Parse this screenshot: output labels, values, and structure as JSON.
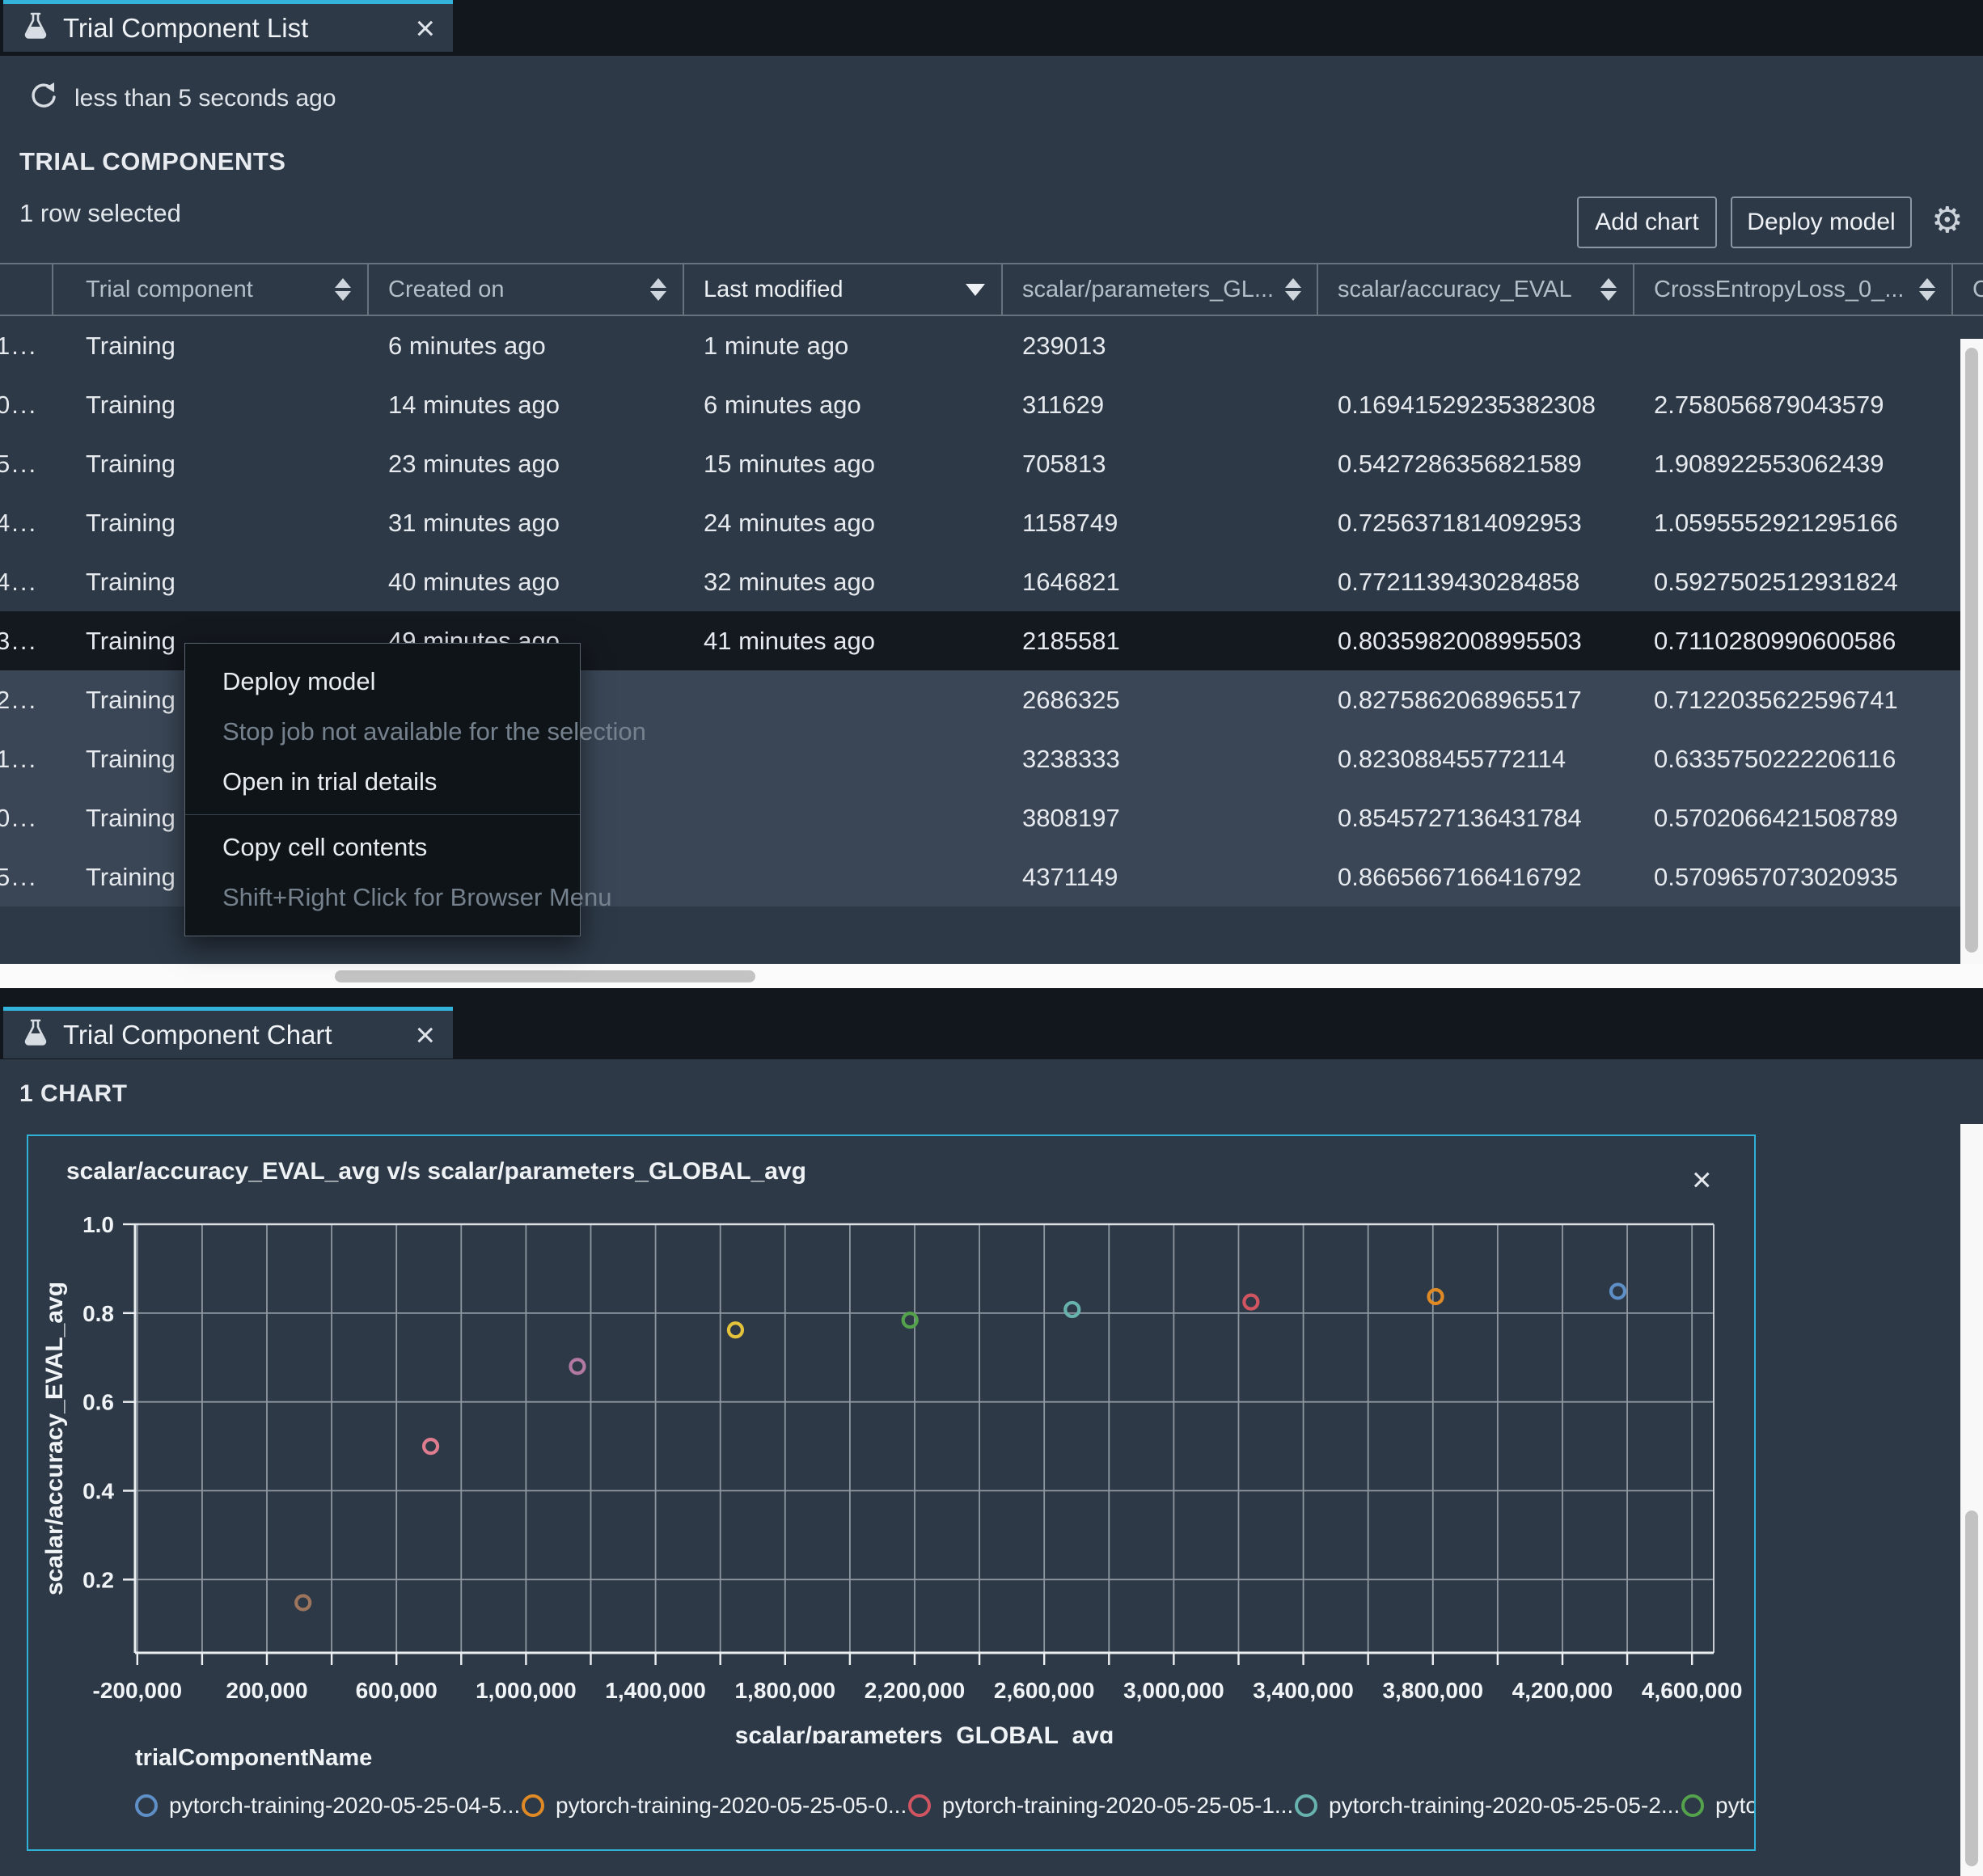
{
  "icons": {
    "close": "×",
    "gear": "⚙",
    "flask": "flask",
    "refresh": "refresh"
  },
  "window1": {
    "tab": {
      "title": "Trial Component List"
    },
    "refresh_status": "less than 5 seconds ago",
    "section_title": "TRIAL COMPONENTS",
    "selection_status": "1 row selected",
    "buttons": {
      "add_chart": "Add chart",
      "deploy_model": "Deploy model"
    },
    "table": {
      "columns": [
        {
          "label": "",
          "sort": "none"
        },
        {
          "label": "Trial component",
          "sort": "both"
        },
        {
          "label": "Created on",
          "sort": "both"
        },
        {
          "label": "Last modified",
          "sort": "desc"
        },
        {
          "label": "scalar/parameters_GL...",
          "sort": "both"
        },
        {
          "label": "scalar/accuracy_EVAL",
          "sort": "both"
        },
        {
          "label": "CrossEntropyLoss_0_...",
          "sort": "both"
        },
        {
          "label": "C",
          "sort": "none"
        }
      ],
      "rows": [
        {
          "name_fragment": "1...",
          "trial_component": "Training",
          "created_on": "6 minutes ago",
          "last_modified": "1 minute ago",
          "parameters": "239013",
          "accuracy": "",
          "loss": "",
          "selected": false
        },
        {
          "name_fragment": "0...",
          "trial_component": "Training",
          "created_on": "14 minutes ago",
          "last_modified": "6 minutes ago",
          "parameters": "311629",
          "accuracy": "0.16941529235382308",
          "loss": "2.758056879043579",
          "selected": false
        },
        {
          "name_fragment": "5...",
          "trial_component": "Training",
          "created_on": "23 minutes ago",
          "last_modified": "15 minutes ago",
          "parameters": "705813",
          "accuracy": "0.5427286356821589",
          "loss": "1.908922553062439",
          "selected": false
        },
        {
          "name_fragment": "4...",
          "trial_component": "Training",
          "created_on": "31 minutes ago",
          "last_modified": "24 minutes ago",
          "parameters": "1158749",
          "accuracy": "0.7256371814092953",
          "loss": "1.0595552921295166",
          "selected": false
        },
        {
          "name_fragment": "4...",
          "trial_component": "Training",
          "created_on": "40 minutes ago",
          "last_modified": "32 minutes ago",
          "parameters": "1646821",
          "accuracy": "0.7721139430284858",
          "loss": "0.5927502512931824",
          "selected": false
        },
        {
          "name_fragment": "3...",
          "trial_component": "Training",
          "created_on": "49 minutes ago",
          "last_modified": "41 minutes ago",
          "parameters": "2185581",
          "accuracy": "0.8035982008995503",
          "loss": "0.7110280990600586",
          "selected": true
        },
        {
          "name_fragment": "2...",
          "trial_component": "Training",
          "created_on": "",
          "last_modified": "",
          "parameters": "2686325",
          "accuracy": "0.8275862068965517",
          "loss": "0.7122035622596741",
          "selected": false
        },
        {
          "name_fragment": "1...",
          "trial_component": "Training",
          "created_on": "",
          "last_modified": "",
          "parameters": "3238333",
          "accuracy": "0.823088455772114",
          "loss": "0.6335750222206116",
          "selected": false
        },
        {
          "name_fragment": "0...",
          "trial_component": "Training",
          "created_on": "",
          "last_modified": "",
          "parameters": "3808197",
          "accuracy": "0.8545727136431784",
          "loss": "0.5702066421508789",
          "selected": false
        },
        {
          "name_fragment": "5...",
          "trial_component": "Training",
          "created_on": "",
          "last_modified": "",
          "parameters": "4371149",
          "accuracy": "0.8665667166416792",
          "loss": "0.5709657073020935",
          "selected": false
        }
      ]
    },
    "context_menu": {
      "items": [
        {
          "type": "item",
          "label": "Deploy model",
          "enabled": true
        },
        {
          "type": "item",
          "label": "Stop job not available for the selection",
          "enabled": false
        },
        {
          "type": "item",
          "label": "Open in trial details",
          "enabled": true
        },
        {
          "type": "separator"
        },
        {
          "type": "item",
          "label": "Copy cell contents",
          "enabled": true
        },
        {
          "type": "item",
          "label": "Shift+Right Click for Browser Menu",
          "enabled": false
        }
      ]
    }
  },
  "window2": {
    "tab": {
      "title": "Trial Component Chart"
    },
    "section_title": "1 CHART",
    "card_title": "scalar/accuracy_EVAL_avg v/s scalar/parameters_GLOBAL_avg"
  },
  "chart_data": {
    "type": "scatter",
    "title": "scalar/accuracy_EVAL_avg v/s scalar/parameters_GLOBAL_avg",
    "xlabel": "scalar/parameters_GLOBAL_avg",
    "ylabel": "scalar/accuracy_EVAL_avg",
    "xlim": [
      -207000,
      4667000
    ],
    "ylim": [
      0.035,
      1.0
    ],
    "x_ticks": [
      -200000,
      200000,
      600000,
      1000000,
      1400000,
      1800000,
      2200000,
      2600000,
      3000000,
      3400000,
      3800000,
      4200000,
      4600000
    ],
    "x_minor_step": 200000,
    "y_ticks": [
      0.2,
      0.4,
      0.6,
      0.8,
      1.0
    ],
    "grid": true,
    "legend_position": "bottom",
    "legend_title": "trialComponentName",
    "points": [
      {
        "x": 311629,
        "y": 0.148,
        "color": "#9d755d"
      },
      {
        "x": 705813,
        "y": 0.5,
        "color": "#e07c90"
      },
      {
        "x": 1158749,
        "y": 0.68,
        "color": "#b279a2"
      },
      {
        "x": 1646821,
        "y": 0.762,
        "color": "#e2c33b"
      },
      {
        "x": 2185581,
        "y": 0.784,
        "color": "#54a24b"
      },
      {
        "x": 2686325,
        "y": 0.808,
        "color": "#68b2ad"
      },
      {
        "x": 3238333,
        "y": 0.825,
        "color": "#d05561"
      },
      {
        "x": 3808197,
        "y": 0.837,
        "color": "#e08a26"
      },
      {
        "x": 4371149,
        "y": 0.849,
        "color": "#5e8fc7"
      }
    ],
    "legend": [
      {
        "label": "pytorch-training-2020-05-25-04-5...",
        "color": "#5e8fc7"
      },
      {
        "label": "pytorch-training-2020-05-25-05-0...",
        "color": "#e08a26"
      },
      {
        "label": "pytorch-training-2020-05-25-05-1...",
        "color": "#d05561"
      },
      {
        "label": "pytorch-training-2020-05-25-05-2...",
        "color": "#68b2ad"
      },
      {
        "label": "pytor",
        "color": "#54a24b"
      }
    ]
  }
}
